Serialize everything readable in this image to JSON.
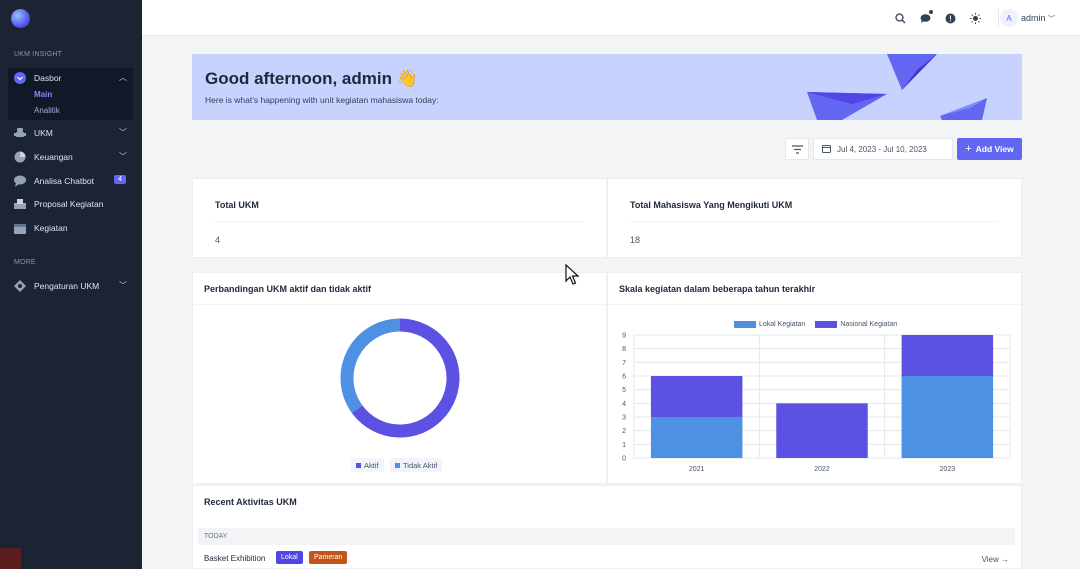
{
  "sidebar": {
    "section_insight": "UKM INSIGHT",
    "dasbor": "Dasbor",
    "dasbor_main": "Main",
    "dasbor_analitik": "Analitik",
    "ukm": "UKM",
    "keuangan": "Keuangan",
    "analisa_chatbot": "Analisa Chatbot",
    "analisa_chatbot_count": "4",
    "proposal": "Proposal Kegiatan",
    "kegiatan": "Kegiatan",
    "section_more": "MORE",
    "pengaturan": "Pengaturan UKM"
  },
  "header": {
    "avatar_initial": "A",
    "user_name": "admin"
  },
  "banner": {
    "greeting": "Good afternoon, admin 👋",
    "subtitle": "Here is what's happening with unit kegiatan mahasiswa today:"
  },
  "toolbar": {
    "date_range": "Jul 4, 2023 - Jul 10, 2023",
    "add_view": "Add View"
  },
  "stats": [
    {
      "title": "Total UKM",
      "value": "4"
    },
    {
      "title": "Total Mahasiswa Yang Mengikuti UKM",
      "value": "18"
    }
  ],
  "colors": {
    "accent": "#6366f1",
    "aktif": "#5b52e3",
    "tidak_aktif": "#4e91e3",
    "lokal": "#4e91e3",
    "nasional": "#5b52e3"
  },
  "chart_data": [
    {
      "type": "pie",
      "title": "Perbandingan UKM aktif dan tidak aktif",
      "donut": true,
      "categories": [
        "Aktif",
        "Tidak Aktif"
      ],
      "values": [
        2.6,
        1.4
      ],
      "legend": "bottom"
    },
    {
      "type": "bar",
      "stacked": true,
      "title": "Skala kegiatan dalam beberapa tahun terakhir",
      "categories": [
        "2021",
        "2022",
        "2023"
      ],
      "series": [
        {
          "name": "Lokal Kegiatan",
          "values": [
            3,
            0,
            6
          ]
        },
        {
          "name": "Nasional Kegiatan",
          "values": [
            3,
            4,
            3
          ]
        }
      ],
      "ylim": [
        0,
        9
      ],
      "yticks": [
        "0",
        "1",
        "2",
        "3",
        "4",
        "5",
        "6",
        "7",
        "8",
        "9"
      ],
      "grid": true,
      "legend": "top"
    }
  ],
  "recent": {
    "title": "Recent Aktivitas UKM",
    "group_label": "TODAY",
    "items": [
      {
        "name": "Basket Exhibition",
        "tag1": "Lokal",
        "tag2": "Pameran",
        "link": "View →"
      }
    ]
  }
}
